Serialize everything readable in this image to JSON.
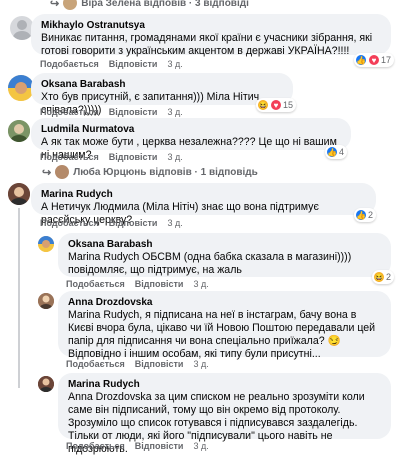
{
  "top_reply": {
    "text": "Віра Зелена відповів · 3 відповіді"
  },
  "comments": [
    {
      "author": "Mikhaylo Ostranutsya",
      "text": "Виникає питання, громадянами якої країни є учасники зібрання, які готові говорити з українським акцентом в державі УКРАЇНА?!!!!",
      "like": "Подобається",
      "reply": "Відповісти",
      "time": "3 д.",
      "reaction_count": "17"
    },
    {
      "author": "Oksana Barabash",
      "text": "Хто був присутній, є запитання))) Міла Нітич співала?)))))",
      "like": "Подобається",
      "reply": "Відповісти",
      "time": "3 д.",
      "reaction_count": "15"
    },
    {
      "author": "Ludmila Nurmatova",
      "text": "А як так може бути , церква незалежна???? Це що ні вашим ні нашим?",
      "like": "Подобається",
      "reply": "Відповісти",
      "time": "3 д.",
      "reaction_count": "4"
    },
    {
      "author": "Marina Rudych",
      "text": "А Нетичук Людмила (Міла Нітіч) знає що вона підтримує расєйську церкву?",
      "like": "Подобається",
      "reply": "Відповісти",
      "time": "3 д.",
      "reaction_count": "2"
    }
  ],
  "reply_summary": {
    "text": "Люба Юрцюнь відповів · 1 відповідь"
  },
  "replies": [
    {
      "author": "Oksana Barabash",
      "text": "Marina Rudych ОБСВМ (одна бабка сказала в магазині)))) повідомляє, що підтримує, на жаль",
      "like": "Подобається",
      "reply": "Відповісти",
      "time": "3 д.",
      "reaction_count": "2"
    },
    {
      "author": "Anna Drozdovska",
      "text": "Marina Rudych, я підписана на неї в інстаграм, бачу вона в Києві вчора була, цікаво чи їй Новою Поштою передавали цей папір для підписання чи вона спеціально приїжала? 😏 Відповідно і іншим особам, які типу були присутні...",
      "like": "Подобається",
      "reply": "Відповісти",
      "time": "3 д."
    },
    {
      "author": "Marina Rudych",
      "text": "Anna Drozdovska за цим списком не реально зрозуміти коли саме він підписаний, тому що він окремо від протоколу. Зрозуміло що список готувався і підписувався заздалегідь. Тільки от люди, які його \"підписували\" цього навіть не підозрюють.",
      "like": "Подобається",
      "reply": "Відповісти",
      "time": "3 д."
    }
  ],
  "colors": {
    "bubble": "#f0f2f5",
    "like_blue": "#1877f2",
    "love_red": "#f33e58",
    "haha_yellow": "#f7b125"
  }
}
